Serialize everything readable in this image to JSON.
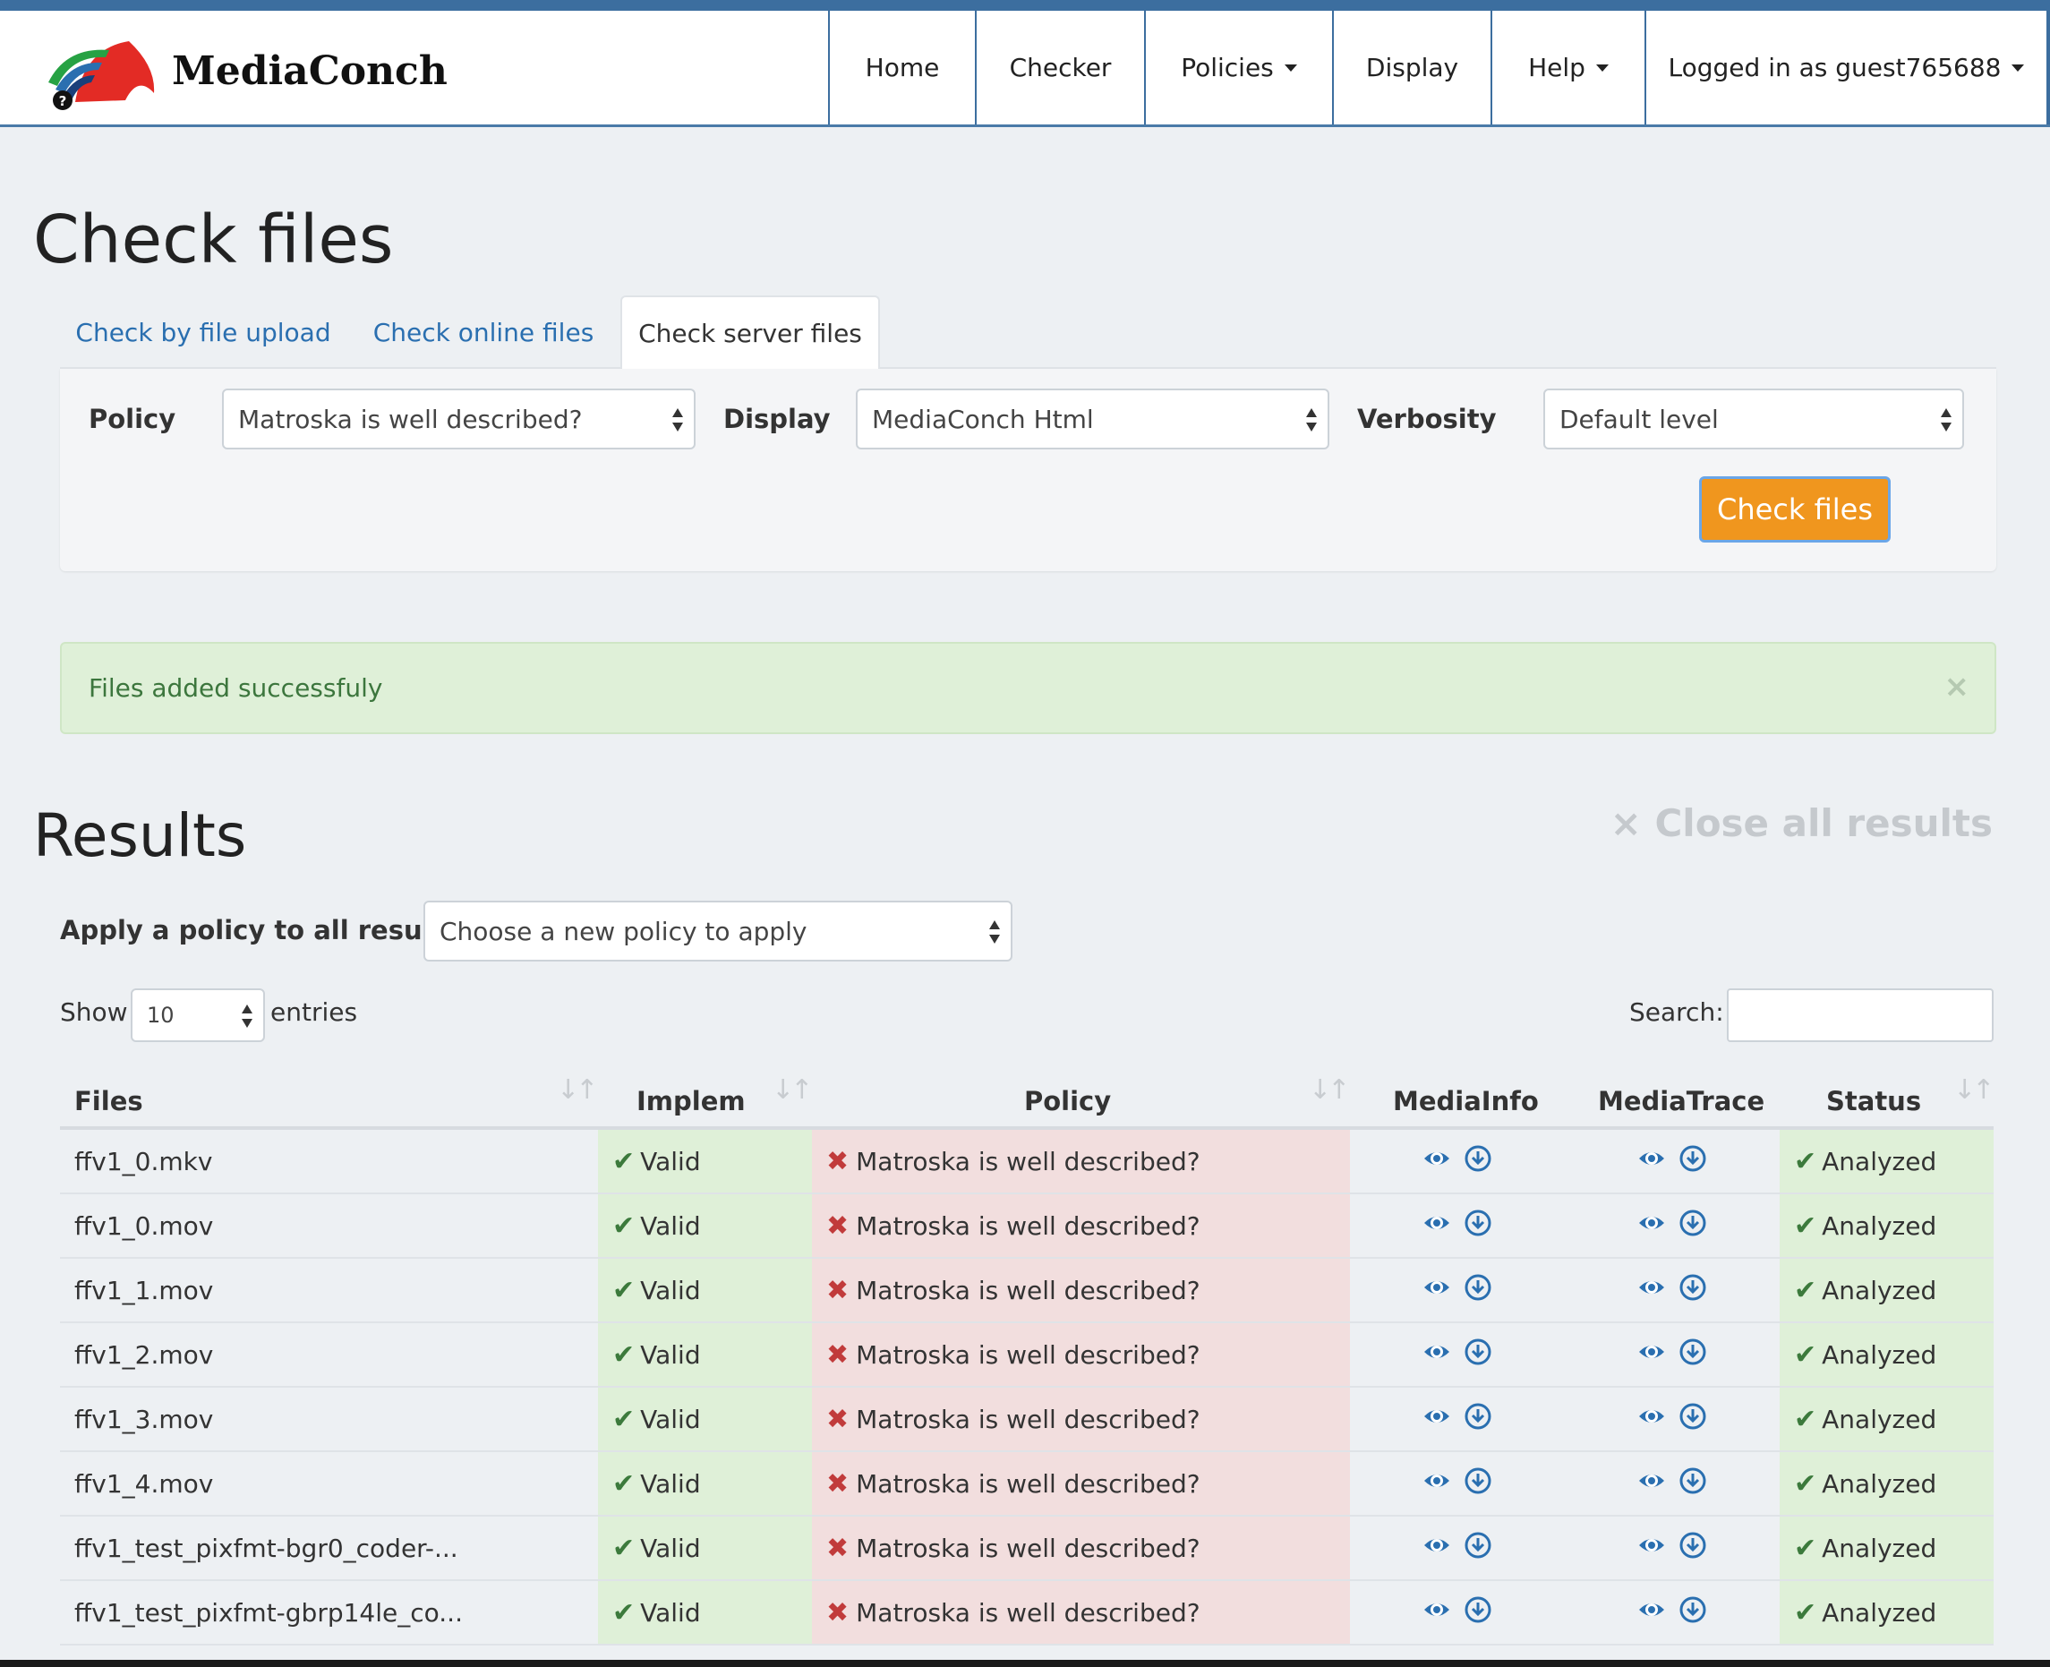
{
  "brand": {
    "name": "MediaConch"
  },
  "nav": [
    {
      "label": "Home",
      "dropdown": false
    },
    {
      "label": "Checker",
      "dropdown": false
    },
    {
      "label": "Policies",
      "dropdown": true
    },
    {
      "label": "Display",
      "dropdown": false
    },
    {
      "label": "Help",
      "dropdown": true
    },
    {
      "label": "Logged in as guest765688",
      "dropdown": true
    }
  ],
  "page": {
    "title": "Check files"
  },
  "tabs": [
    {
      "label": "Check by file upload",
      "active": false
    },
    {
      "label": "Check online files",
      "active": false
    },
    {
      "label": "Check server files",
      "active": true
    }
  ],
  "form": {
    "policy_label": "Policy",
    "policy_value": "Matroska is well described?",
    "display_label": "Display",
    "display_value": "MediaConch Html",
    "verbosity_label": "Verbosity",
    "verbosity_value": "Default level",
    "check_button": "Check files"
  },
  "alert": {
    "message": "Files added successfuly",
    "close": "×"
  },
  "results": {
    "title": "Results",
    "close_all": "× Close all results",
    "apply_label": "Apply a policy to all results",
    "apply_placeholder": "Choose a new policy to apply",
    "show_label": "Show",
    "show_value": "10",
    "entries_label": "entries",
    "search_label": "Search:",
    "search_value": ""
  },
  "table": {
    "columns": [
      "Files",
      "Implem",
      "Policy",
      "MediaInfo",
      "MediaTrace",
      "Status"
    ],
    "rows": [
      {
        "file": "ffv1_0.mkv",
        "implem": "Valid",
        "policy": "Matroska is well described?",
        "status": "Analyzed"
      },
      {
        "file": "ffv1_0.mov",
        "implem": "Valid",
        "policy": "Matroska is well described?",
        "status": "Analyzed"
      },
      {
        "file": "ffv1_1.mov",
        "implem": "Valid",
        "policy": "Matroska is well described?",
        "status": "Analyzed"
      },
      {
        "file": "ffv1_2.mov",
        "implem": "Valid",
        "policy": "Matroska is well described?",
        "status": "Analyzed"
      },
      {
        "file": "ffv1_3.mov",
        "implem": "Valid",
        "policy": "Matroska is well described?",
        "status": "Analyzed"
      },
      {
        "file": "ffv1_4.mov",
        "implem": "Valid",
        "policy": "Matroska is well described?",
        "status": "Analyzed"
      },
      {
        "file": "ffv1_test_pixfmt-bgr0_coder-...",
        "implem": "Valid",
        "policy": "Matroska is well described?",
        "status": "Analyzed"
      },
      {
        "file": "ffv1_test_pixfmt-gbrp14le_co...",
        "implem": "Valid",
        "policy": "Matroska is well described?",
        "status": "Analyzed"
      }
    ]
  },
  "colors": {
    "accent": "#3c6e9f",
    "button": "#f0961e",
    "valid_bg": "#dff0d8",
    "invalid_bg": "#f2dede",
    "icon_blue": "#2a6fb0"
  }
}
